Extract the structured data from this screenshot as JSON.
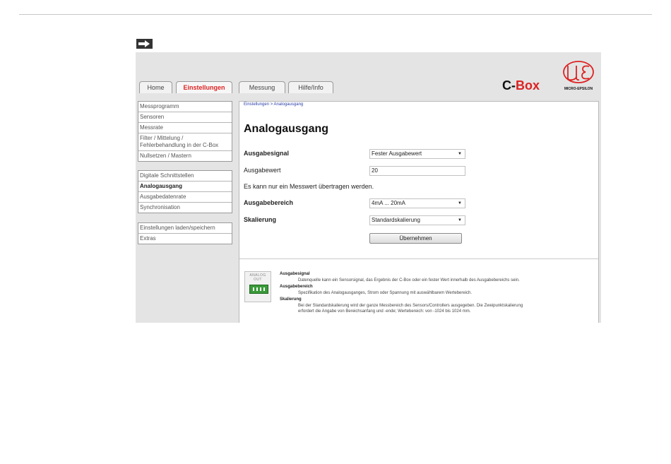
{
  "header_arrow_icon": "right-arrow-icon",
  "tabs": [
    {
      "label": "Home"
    },
    {
      "label": "Einstellungen",
      "active": true
    },
    {
      "label": "Messung"
    },
    {
      "label": "Hilfe/Info"
    }
  ],
  "brand": {
    "prefix": "C-",
    "suffix": "Box",
    "logo_icon": "micro-epsilon-logo",
    "logo_text": "MICRO-EPSILON"
  },
  "sidebar": {
    "group1": [
      {
        "label": "Messprogramm"
      },
      {
        "label": "Sensoren"
      },
      {
        "label": "Messrate"
      },
      {
        "label": "Filter / Mittelung / Fehlerbehandlung in der C-Box"
      },
      {
        "label": "Nullsetzen / Mastern"
      }
    ],
    "group2": [
      {
        "label": "Digitale Schnittstellen"
      },
      {
        "label": "Analogausgang",
        "active": true
      },
      {
        "label": "Ausgabedatenrate"
      },
      {
        "label": "Synchronisation"
      }
    ],
    "group3": [
      {
        "label": "Einstellungen laden/speichern"
      },
      {
        "label": "Extras"
      }
    ]
  },
  "main": {
    "breadcrumb": "Einstellungen > Analogausgang",
    "title": "Analogausgang",
    "ausgabesignal_label": "Ausgabesignal",
    "ausgabesignal_value": "Fester Ausgabewert",
    "ausgabewert_label": "Ausgabewert",
    "ausgabewert_value": "20",
    "info_text": "Es kann nur ein Messwert übertragen werden.",
    "ausgabebereich_label": "Ausgabebereich",
    "ausgabebereich_value": "4mA ... 20mA",
    "skalierung_label": "Skalierung",
    "skalierung_value": "Standardskalierung",
    "apply_label": "Übernehmen"
  },
  "help": {
    "icon_label_line1": "ANALOG",
    "icon_label_line2": "OUT",
    "signal_head": "Ausgabesignal",
    "signal_text": "Datenquelle kann ein Sensorsignal, das Ergebnis der C-Box oder ein fester Wert innerhalb des Ausgabebereichs sein.",
    "range_head": "Ausgabebereich",
    "range_text": "Spezifikation des Analogausganges, Strom oder Spannung mit auswählbarem Wertebereich.",
    "scale_head": "Skalierung",
    "scale_text1": "Bei der Standardskalierung wird der ganze Messbereich des Sensors/Controllers ausgegeben. Die Zweipunktskalierung",
    "scale_text2": "erfordert die Angabe von Bereichsanfang und -ende; Wertebereich: von -1024 bis 1024 mm."
  },
  "colors": {
    "accent_red": "#dd2222",
    "breadcrumb_blue": "#2a3fa8",
    "connector_green": "#3a9a3a"
  }
}
